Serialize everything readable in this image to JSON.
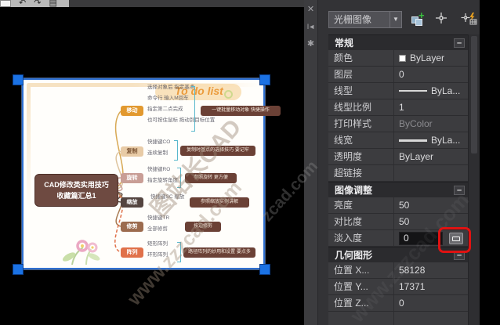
{
  "window": {
    "qat_icons": [
      "undo-arrow",
      "redo-arrow",
      "plot-icon"
    ],
    "undo_glyph": "↶",
    "redo_glyph": "↷",
    "plot_glyph": "▤"
  },
  "palette": {
    "titlebar": {
      "close": "✕",
      "autohide": "I◄",
      "menu": "✱"
    },
    "selector": {
      "value": "光栅图像",
      "arrow": "▼"
    },
    "sections": [
      {
        "title": "常规",
        "collapse": "–",
        "rows": [
          {
            "label": "颜色",
            "value": "ByLayer"
          },
          {
            "label": "图层",
            "value": "0"
          },
          {
            "label": "线型",
            "value": "ByLa..."
          },
          {
            "label": "线型比例",
            "value": "1"
          },
          {
            "label": "打印样式",
            "value": "ByColor"
          },
          {
            "label": "线宽",
            "value": "ByLa..."
          },
          {
            "label": "透明度",
            "value": "ByLayer"
          },
          {
            "label": "超链接",
            "value": ""
          }
        ]
      },
      {
        "title": "图像调整",
        "collapse": "–",
        "rows": [
          {
            "label": "亮度",
            "value": "50"
          },
          {
            "label": "对比度",
            "value": "50"
          },
          {
            "label": "淡入度",
            "value": "0"
          }
        ]
      },
      {
        "title": "几何图形",
        "collapse": "–",
        "rows": [
          {
            "label": "位置 X...",
            "value": "58128"
          },
          {
            "label": "位置 Y...",
            "value": "17371"
          },
          {
            "label": "位置 Z...",
            "value": "0"
          }
        ]
      }
    ]
  },
  "canvas": {
    "mindmap": {
      "title": "To do list",
      "center": {
        "line1": "CAD修改类实用技巧",
        "line2": "收藏篇汇总1"
      },
      "branches": [
        {
          "label": "移动",
          "children": [
            "选择对象后 指定基点",
            "命令行 输入M回车",
            "指定第二点完成",
            "也可按住鼠标 拖动到目标位置"
          ],
          "callout": "一键批量移动对象 快捷操作"
        },
        {
          "label": "复制",
          "children": [
            "快捷键CO",
            "连续复制"
          ],
          "callout": "复制时基点的选择技巧 要记牢"
        },
        {
          "label": "旋转",
          "children": [
            "快捷键RO",
            "指定旋转角度"
          ],
          "callout": "参照旋转 更方便"
        },
        {
          "label": "缩放",
          "children": [
            "快捷键SC 缩放"
          ],
          "callout": "参照缩放实例讲解"
        },
        {
          "label": "修剪",
          "children": [
            "快捷键TR",
            "全部修剪"
          ],
          "callout": "按边修剪"
        },
        {
          "label": "阵列",
          "children": [
            "矩形阵列",
            "环形阵列"
          ],
          "callout": "路径阵列的妙用和设置 要点多"
        }
      ]
    }
  },
  "watermark": {
    "name": "图站长CAD",
    "site": "www.zzzcad.com",
    "fragment": "zcad.com"
  },
  "colors": {
    "grip_blue": "#1b72e4",
    "selection_blue": "#2e6fd0",
    "annotation_red": "#e01212",
    "palette_bg": "#333336",
    "row_bg": "#3c3c3f",
    "section_bg": "#2b2b2e"
  }
}
